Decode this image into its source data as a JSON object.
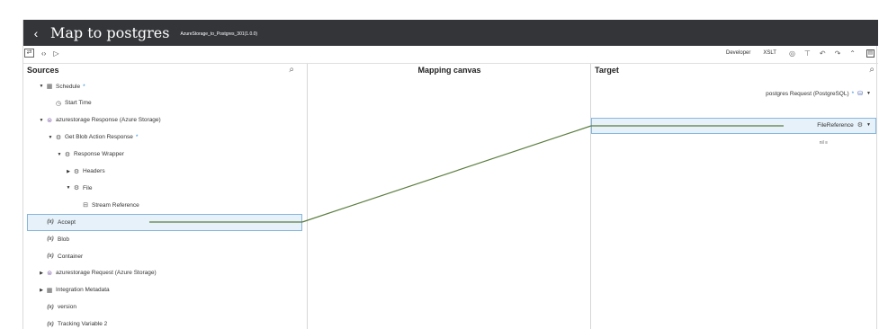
{
  "header": {
    "back_glyph": "‹",
    "title": "Map to postgres",
    "subtitle": "AzureStorage_to_Postgres_301(1.0.0)"
  },
  "toolbar": {
    "swap_glyph": "⇄",
    "code_glyph": "‹›",
    "play_glyph": "▷",
    "developer": "Developer",
    "xslt": "XSLT",
    "view_glyph": "◎",
    "filter_glyph": "⊤",
    "undo_glyph": "↶",
    "redo_glyph": "↷",
    "collapse_glyph": "⌃",
    "panel_glyph": "▤"
  },
  "sources": {
    "title": "Sources",
    "search_glyph": "⌕",
    "items": [
      {
        "label": "Schedule",
        "star": "*",
        "icon": "▦",
        "caret": "▼",
        "indent": 1
      },
      {
        "label": "Start Time",
        "star": "",
        "icon": "◷",
        "caret": "",
        "indent": 2
      },
      {
        "label": "azurestorage Response (Azure Storage)",
        "star": "",
        "icon": "⊜",
        "caret": "▼",
        "indent": 1
      },
      {
        "label": "Get Blob Action Response",
        "star": "*",
        "icon": "⚙",
        "caret": "▼",
        "indent": 2
      },
      {
        "label": "Response Wrapper",
        "star": "",
        "icon": "⚙",
        "caret": "▼",
        "indent": 3
      },
      {
        "label": "Headers",
        "star": "",
        "icon": "⚙",
        "caret": "▶",
        "indent": 4
      },
      {
        "label": "File",
        "star": "",
        "icon": "⚙",
        "caret": "▼",
        "indent": 4
      },
      {
        "label": "Stream Reference",
        "star": "",
        "icon": "⊟",
        "caret": "",
        "indent": 5
      },
      {
        "label": "Accept",
        "star": "",
        "icon": "(x)",
        "caret": "",
        "indent": 1
      },
      {
        "label": "Blob",
        "star": "",
        "icon": "(x)",
        "caret": "",
        "indent": 1
      },
      {
        "label": "Container",
        "star": "",
        "icon": "(x)",
        "caret": "",
        "indent": 1
      },
      {
        "label": "azurestorage Request (Azure Storage)",
        "star": "",
        "icon": "⊜",
        "caret": "▶",
        "indent": 1
      },
      {
        "label": "Integration Metadata",
        "star": "",
        "icon": "▦",
        "caret": "▶",
        "indent": 1
      },
      {
        "label": "version",
        "star": "",
        "icon": "(x)",
        "caret": "",
        "indent": 1
      },
      {
        "label": "Tracking Variable 2",
        "star": "",
        "icon": "(x)",
        "caret": "",
        "indent": 1
      }
    ]
  },
  "canvas": {
    "title": "Mapping canvas"
  },
  "target": {
    "title": "Target",
    "search_glyph": "⌕",
    "root_label": "postgres Request (PostgreSQL)",
    "root_star": "*",
    "file_reference": "FileReference",
    "null_indicator": "nil ≡",
    "db_glyph": "⛁",
    "gear_glyph": "⚙",
    "menu_glyph": "▼"
  },
  "colors": {
    "header_bg": "#333539",
    "wire": "#5b7d3f",
    "selection_bg": "#e6f1f9",
    "selection_border": "#87b7de",
    "required_star": "#2a8bd8"
  }
}
